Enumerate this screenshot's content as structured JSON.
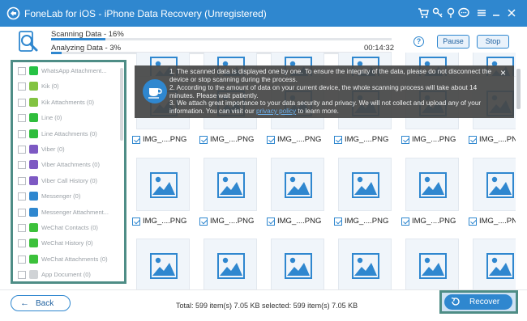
{
  "app": {
    "title": "FoneLab for iOS - iPhone Data Recovery (Unregistered)",
    "accent_color": "#2f87cf",
    "highlight_color": "#4e8d86",
    "title_icons": [
      "cart-icon",
      "key-icon",
      "pin-icon",
      "chat-icon",
      "menu-icon",
      "minimize-icon",
      "close-icon"
    ]
  },
  "scan": {
    "scanning_label": "Scanning Data - 16%",
    "scanning_progress": 0.16,
    "analyzing_label": "Analyzing Data - 3%",
    "analyzing_progress": 0.03,
    "elapsed": "00:14:32",
    "pause_label": "Pause",
    "stop_label": "Stop"
  },
  "sidebar": {
    "items": [
      {
        "label": "WhatsApp Attachment...",
        "icon": "whatsapp-icon",
        "color": "#25c244"
      },
      {
        "label": "Kik (0)",
        "icon": "kik-icon",
        "color": "#82c341"
      },
      {
        "label": "Kik Attachments (0)",
        "icon": "kik-icon",
        "color": "#82c341"
      },
      {
        "label": "Line (0)",
        "icon": "line-icon",
        "color": "#2fbd3c"
      },
      {
        "label": "Line Attachments (0)",
        "icon": "line-icon",
        "color": "#2fbd3c"
      },
      {
        "label": "Viber (0)",
        "icon": "viber-icon",
        "color": "#7d59c3"
      },
      {
        "label": "Viber Attachments (0)",
        "icon": "viber-icon",
        "color": "#7d59c3"
      },
      {
        "label": "Viber Call History (0)",
        "icon": "viber-icon",
        "color": "#7d59c3"
      },
      {
        "label": "Messenger (0)",
        "icon": "messenger-icon",
        "color": "#2f87cf"
      },
      {
        "label": "Messenger Attachment...",
        "icon": "messenger-icon",
        "color": "#2f87cf"
      },
      {
        "label": "WeChat Contacts (0)",
        "icon": "wechat-icon",
        "color": "#3cc13b"
      },
      {
        "label": "WeChat History (0)",
        "icon": "wechat-icon",
        "color": "#3cc13b"
      },
      {
        "label": "WeChat Attachments (0)",
        "icon": "wechat-icon",
        "color": "#3cc13b"
      },
      {
        "label": "App Document (0)",
        "icon": "document-icon",
        "color": "#d0d3d6"
      }
    ]
  },
  "notice": {
    "line1": "1. The scanned data is displayed one by one. To ensure the integrity of the data, please do not disconnect the",
    "line2": "device or stop scanning during the process.",
    "line3": "2. According to the amount of data on your current device, the whole scanning process will take about 14",
    "line4": "minutes. Please wait patiently.",
    "line5": "3. We attach great importance to your data security and privacy. We will not collect and upload any of your",
    "line6_prefix": "information. You can visit our ",
    "line6_link": "privacy policy",
    "line6_suffix": " to learn more.",
    "close": "×"
  },
  "grid": {
    "row_labels": [
      [
        "IMG_....PNG",
        "IMG_....PNG",
        "IMG_....PNG",
        "IMG_....PNG",
        "IMG_....PNG",
        "IMG_....PNG"
      ],
      [
        "IMG_....PNG",
        "IMG_....PNG",
        "IMG_....PNG",
        "IMG_....PNG",
        "IMG_....PNG",
        "IMG_....PNG"
      ],
      [
        "IMG_....PNG",
        "IMG_....PNG",
        "IMG_....PNG",
        "IMG_....PNG",
        "IMG_....PNG",
        "IMG_....PNG"
      ]
    ]
  },
  "footer": {
    "back_label": "Back",
    "totals": "Total: 599 item(s) 7.05 KB    selected: 599 item(s) 7.05 KB",
    "recover_label": "Recover"
  }
}
